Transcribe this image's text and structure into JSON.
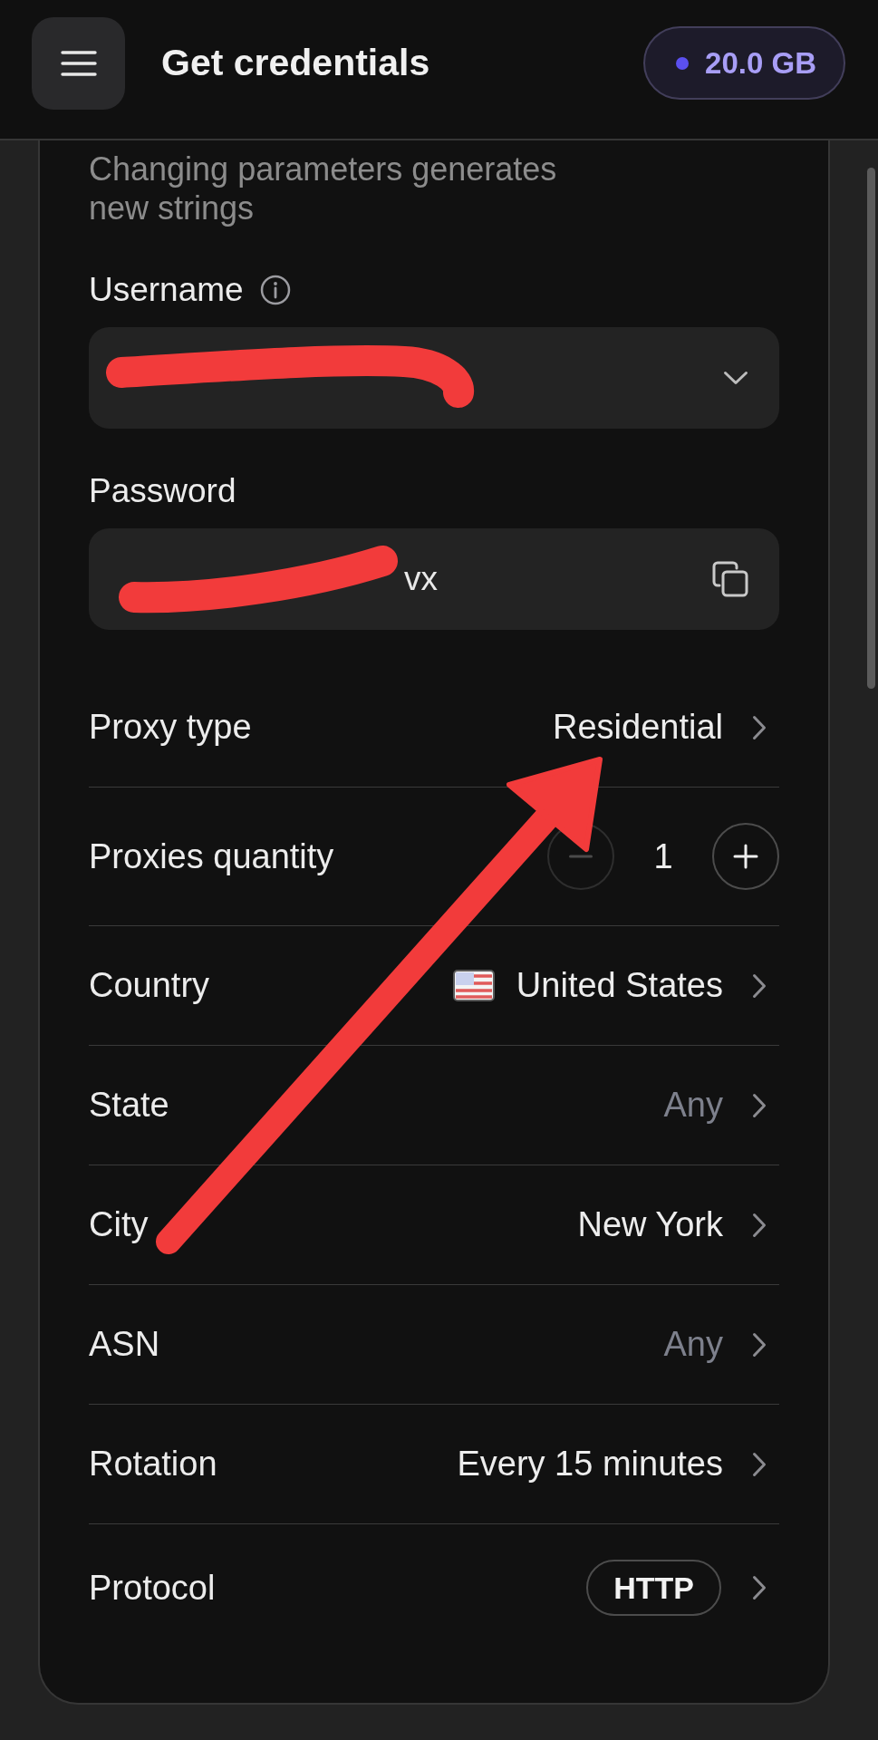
{
  "header": {
    "title": "Get credentials",
    "balance": "20.0 GB"
  },
  "description": "Changing parameters generates new strings",
  "credentials": [
    {
      "label": "Username",
      "kind": "dropdown",
      "info": true,
      "redacted": true
    },
    {
      "label": "Password",
      "kind": "copy",
      "info": false,
      "redacted": true,
      "value": "vx"
    }
  ],
  "rows": [
    {
      "kind": "select",
      "label": "Proxy type",
      "value": "Residential"
    },
    {
      "kind": "stepper",
      "label": "Proxies quantity",
      "value": "1",
      "decrease": {
        "disabled": true
      },
      "increase": {
        "disabled": false
      }
    },
    {
      "kind": "country",
      "label": "Country",
      "value": "United States"
    },
    {
      "kind": "select",
      "label": "State",
      "placeholder": "Any"
    },
    {
      "kind": "select",
      "label": "City",
      "value": "New York"
    },
    {
      "kind": "select",
      "label": "ASN",
      "placeholder": "Any"
    },
    {
      "kind": "select",
      "label": "Rotation",
      "value": "Every 15 minutes"
    },
    {
      "kind": "pill",
      "label": "Protocol",
      "value": "HTTP"
    }
  ]
}
